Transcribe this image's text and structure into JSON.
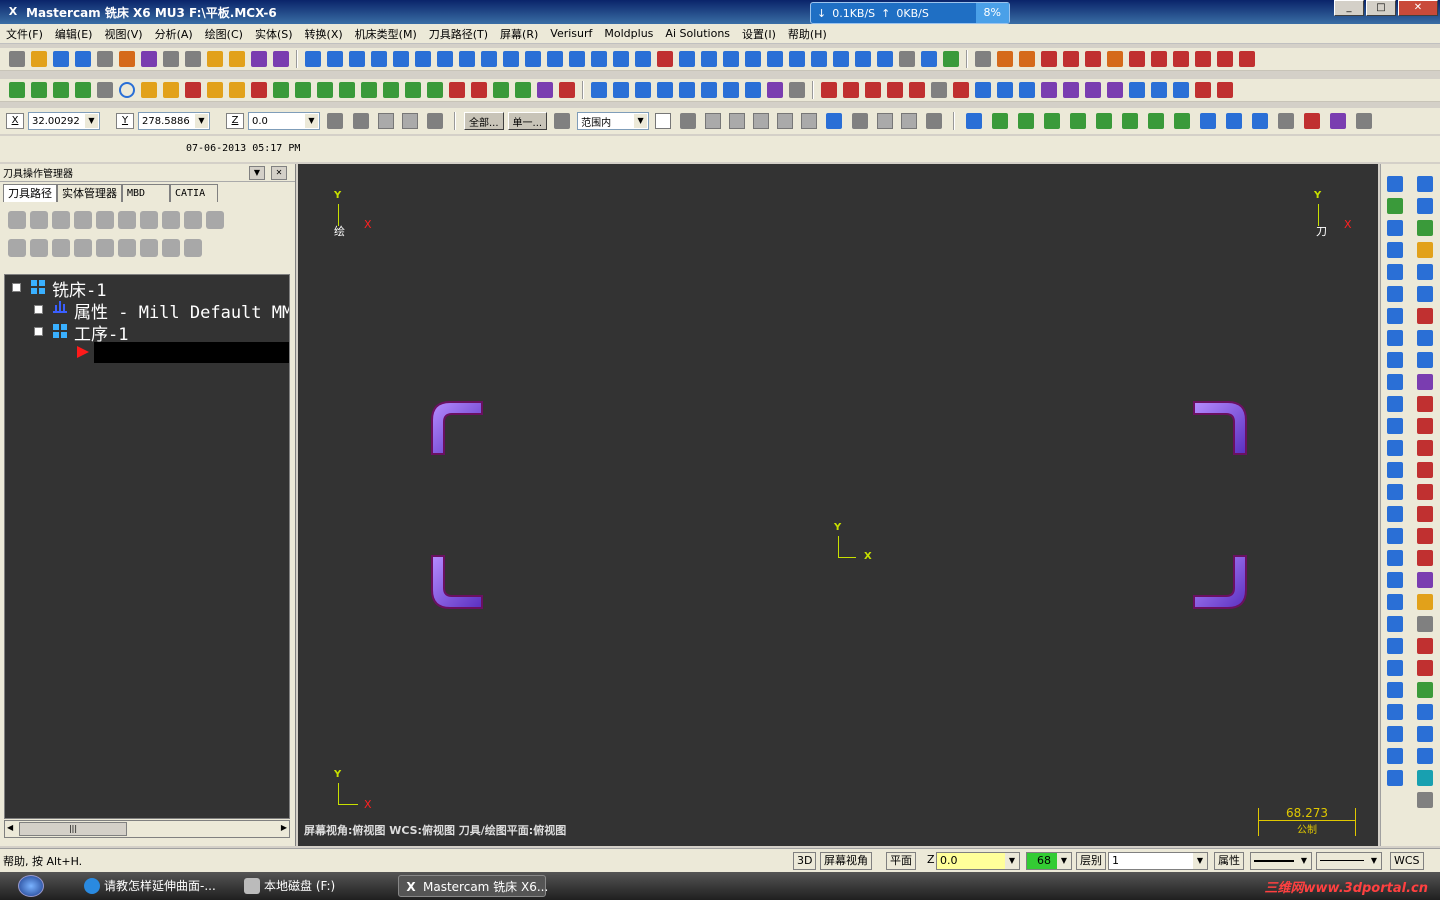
{
  "window": {
    "title": "Mastercam 铣床 X6 MU3  F:\\平板.MCX-6",
    "net": {
      "down": "0.1KB/S",
      "up": "0KB/S",
      "percent": "8%"
    }
  },
  "menu": [
    "文件(F)",
    "编辑(E)",
    "视图(V)",
    "分析(A)",
    "绘图(C)",
    "实体(S)",
    "转换(X)",
    "机床类型(M)",
    "刀具路径(T)",
    "屏幕(R)",
    "Verisurf",
    "Moldplus",
    "Ai Solutions",
    "设置(I)",
    "帮助(H)"
  ],
  "coords": {
    "x_label": "X",
    "x_value": "32.00292",
    "y_label": "Y",
    "y_value": "278.5886",
    "z_label": "Z",
    "z_value": "0.0",
    "all_label": "全部...",
    "single_label": "单一...",
    "range_value": "范围内"
  },
  "date": "07-06-2013 05:17 PM",
  "panel": {
    "title": "刀具操作管理器",
    "tabs": [
      "刀具路径",
      "实体管理器",
      "MBD",
      "CATIA"
    ],
    "tree": {
      "machine": "铣床-1",
      "properties": "属性 - Mill Default MM",
      "group": "工序-1"
    }
  },
  "viewport": {
    "axis_y": "Y",
    "axis_x": "X",
    "gview_label": "绘",
    "tplane_label": "刀",
    "info": "屏幕视角:俯视图   WCS:俯视图   刀具/绘图平面:俯视图",
    "scale_value": "68.273",
    "scale_unit": "公制"
  },
  "status": {
    "help": "帮助, 按 Alt+H.",
    "mode_3d": "3D",
    "screen_view": "屏幕视角",
    "plane": "平面",
    "z_label": "Z",
    "z_value": "0.0",
    "color_value": "68",
    "level_label": "层别",
    "level_value": "1",
    "attr_label": "属性",
    "wcs_label": "WCS"
  },
  "taskbar": {
    "items": [
      "请教怎样延伸曲面-...",
      "本地磁盘 (F:)",
      "Mastercam 铣床 X6..."
    ],
    "watermark": "三维网www.3dportal.cn"
  }
}
